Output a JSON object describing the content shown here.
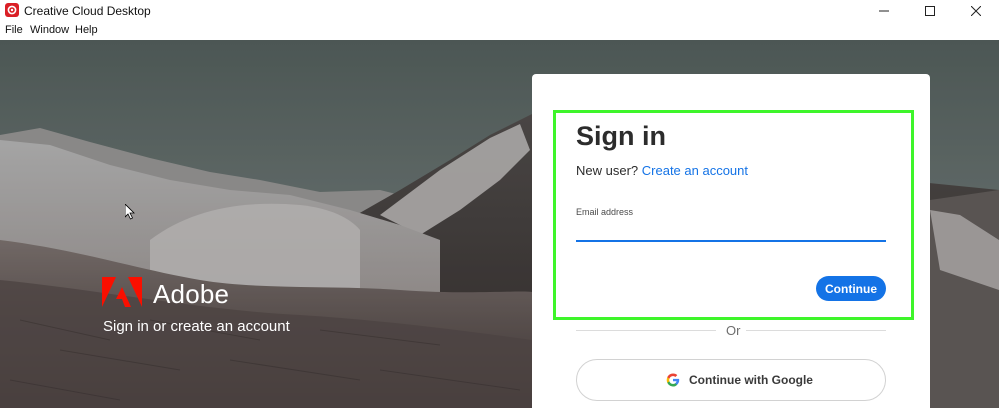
{
  "window": {
    "title": "Creative Cloud Desktop"
  },
  "menu": {
    "items": [
      "File",
      "Window",
      "Help"
    ]
  },
  "brand": {
    "name": "Adobe",
    "tagline": "Sign in or create an account"
  },
  "signin": {
    "title": "Sign in",
    "new_user_prefix": "New user?",
    "create_account_link": "Create an account",
    "email_label": "Email address",
    "email_value": "",
    "continue_label": "Continue",
    "or_label": "Or",
    "google_label": "Continue with Google"
  },
  "colors": {
    "accent": "#1473e6",
    "brand_red": "#da1f26",
    "highlight_green": "#3ef52a"
  },
  "icons": {
    "app": "creative-cloud-icon",
    "minimize": "minimize-icon",
    "maximize": "maximize-icon",
    "close": "close-icon",
    "google": "google-icon",
    "adobe": "adobe-logo-icon",
    "cursor": "mouse-cursor-icon"
  }
}
